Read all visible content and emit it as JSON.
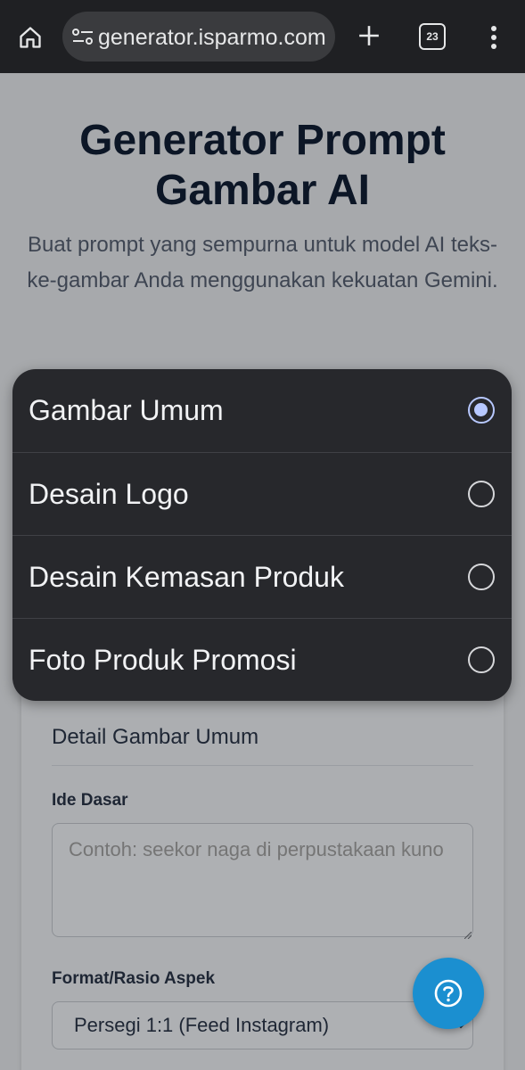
{
  "browser": {
    "url_visible": "generator.isparmo.com",
    "tab_count": "23"
  },
  "page": {
    "title": "Generator Prompt Gambar AI",
    "subtitle": "Buat prompt yang sempurna untuk model AI teks-ke-gambar Anda menggunakan kekuatan Gemini."
  },
  "dropdown": {
    "options": [
      {
        "label": "Gambar Umum",
        "selected": true
      },
      {
        "label": "Desain Logo",
        "selected": false
      },
      {
        "label": "Desain Kemasan Produk",
        "selected": false
      },
      {
        "label": "Foto Produk Promosi",
        "selected": false
      }
    ]
  },
  "form": {
    "section_title": "Detail Gambar Umum",
    "idea_label": "Ide Dasar",
    "idea_placeholder": "Contoh: seekor naga di perpustakaan kuno",
    "idea_value": "",
    "aspect_label": "Format/Rasio Aspek",
    "aspect_value": "Persegi 1:1 (Feed Instagram)"
  },
  "colors": {
    "accent_fab": "#1b8fd0",
    "radio_selected": "#b7c8ff",
    "menu_bg": "#27282c"
  }
}
